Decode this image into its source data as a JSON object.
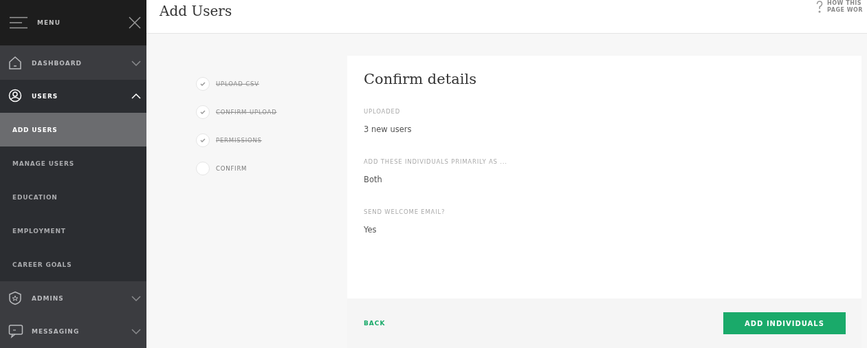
{
  "sidebar": {
    "header": {
      "label": "MENU"
    },
    "items": [
      {
        "label": "DASHBOARD",
        "expanded": false
      },
      {
        "label": "USERS",
        "expanded": true,
        "children": [
          {
            "label": "ADD USERS",
            "selected": true
          },
          {
            "label": "MANAGE USERS",
            "selected": false
          },
          {
            "label": "EDUCATION",
            "selected": false
          },
          {
            "label": "EMPLOYMENT",
            "selected": false
          },
          {
            "label": "CAREER GOALS",
            "selected": false
          }
        ]
      },
      {
        "label": "ADMINS",
        "expanded": false
      },
      {
        "label": "MESSAGING",
        "expanded": false
      }
    ]
  },
  "header": {
    "title": "Add Users",
    "help": [
      "HOW THIS",
      "PAGE WOR"
    ]
  },
  "steps": [
    {
      "label": "UPLOAD-CSV",
      "done": true
    },
    {
      "label": "CONFIRM-UPLOAD",
      "done": true
    },
    {
      "label": "PERMISSIONS",
      "done": true
    },
    {
      "label": "CONFIRM",
      "done": false
    }
  ],
  "card": {
    "title": "Confirm details",
    "fields": [
      {
        "label": "UPLOADED",
        "value": "3 new users"
      },
      {
        "label": "ADD THESE INDIVIDUALS PRIMARILY AS ...",
        "value": "Both"
      },
      {
        "label": "SEND WELCOME EMAIL?",
        "value": "Yes"
      }
    ],
    "back": "BACK",
    "submit": "ADD INDIVIDUALS"
  }
}
